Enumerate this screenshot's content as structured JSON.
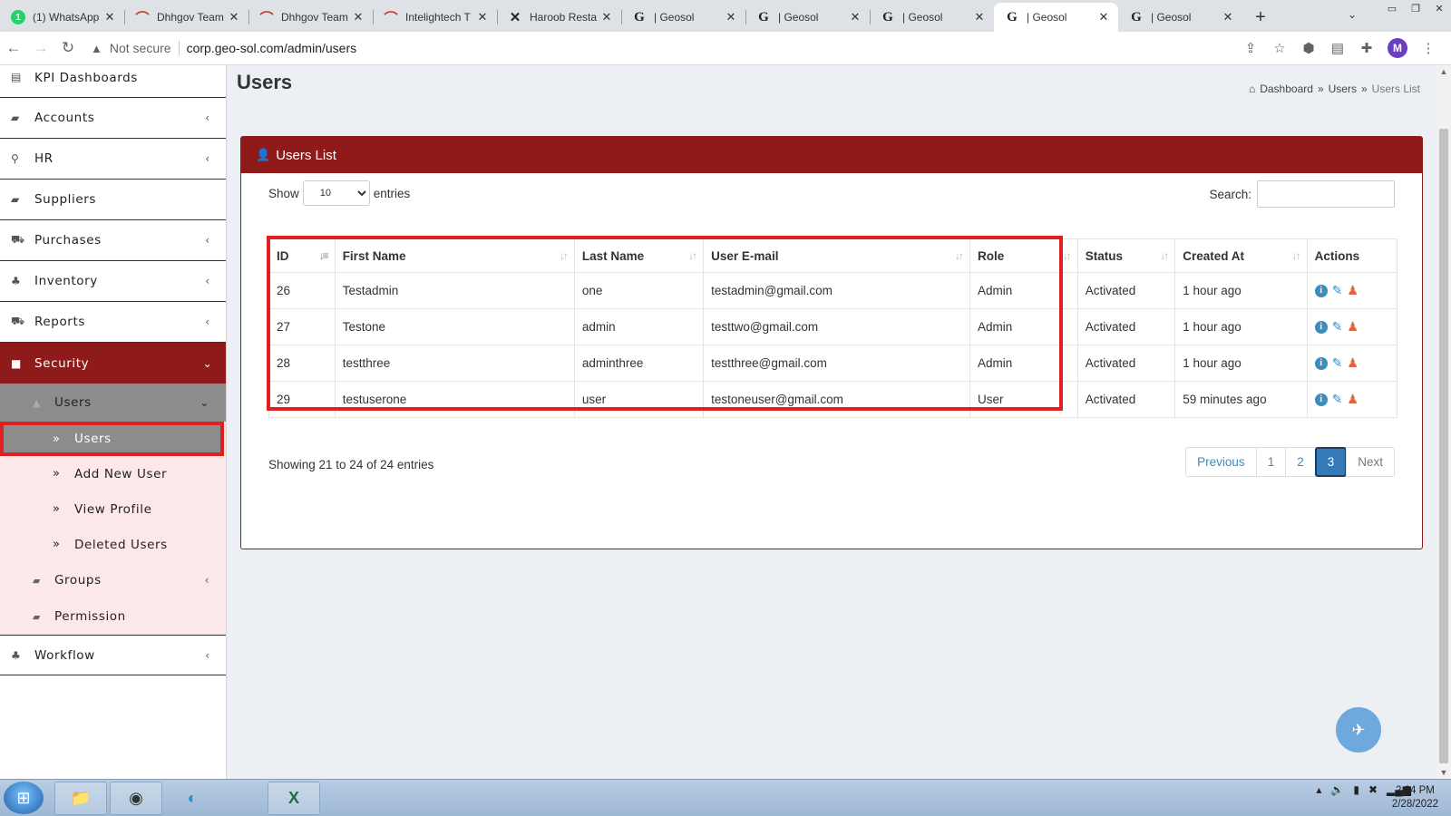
{
  "browser": {
    "tabs": [
      {
        "favicon": "whatsapp-icon",
        "glyph": "1",
        "title": "(1) WhatsApp"
      },
      {
        "favicon": "arc-icon",
        "glyph": "⌒",
        "title": "Dhhgov Team"
      },
      {
        "favicon": "arc-icon",
        "glyph": "⌒",
        "title": "Dhhgov Team"
      },
      {
        "favicon": "arc-icon",
        "glyph": "⌒",
        "title": "Intelightech T"
      },
      {
        "favicon": "x-icon",
        "glyph": "✕",
        "title": "Haroob Resta"
      },
      {
        "favicon": "g-icon",
        "glyph": "G",
        "title": "| Geosol"
      },
      {
        "favicon": "g-icon",
        "glyph": "G",
        "title": "| Geosol"
      },
      {
        "favicon": "g-icon",
        "glyph": "G",
        "title": "| Geosol"
      },
      {
        "favicon": "g-icon",
        "glyph": "G",
        "title": "| Geosol"
      },
      {
        "favicon": "g-icon",
        "glyph": "G",
        "title": "| Geosol"
      }
    ],
    "active_tab": 8,
    "security_label": "Not secure",
    "url": "corp.geo-sol.com/admin/users",
    "avatar_letter": "M"
  },
  "sidebar": {
    "items_top": [
      {
        "label": "KPI Dashboards",
        "icon": "dashboard-icon",
        "glyph": "▤",
        "chevron": false
      },
      {
        "label": "Accounts",
        "icon": "accounts-icon",
        "glyph": "▰",
        "chevron": true
      },
      {
        "label": "HR",
        "icon": "hr-icon",
        "glyph": "⚲",
        "chevron": true
      },
      {
        "label": "Suppliers",
        "icon": "truck-icon",
        "glyph": "▰",
        "chevron": false
      },
      {
        "label": "Purchases",
        "icon": "cart-icon",
        "glyph": "⛟",
        "chevron": true
      },
      {
        "label": "Inventory",
        "icon": "sitemap-icon",
        "glyph": "♣",
        "chevron": true
      },
      {
        "label": "Reports",
        "icon": "cart-icon",
        "glyph": "⛟",
        "chevron": true
      }
    ],
    "security": {
      "label": "Security",
      "glyph": "🔒"
    },
    "users_group": {
      "label": "Users"
    },
    "users_children": [
      {
        "label": "Users"
      },
      {
        "label": "Add New User"
      },
      {
        "label": "View Profile"
      },
      {
        "label": "Deleted Users"
      }
    ],
    "groups": {
      "label": "Groups"
    },
    "permission": {
      "label": "Permission"
    },
    "workflow": {
      "label": "Workflow"
    }
  },
  "page": {
    "title": "Users",
    "breadcrumb": [
      "Dashboard",
      "Users",
      "Users List"
    ],
    "box_title": "Users List"
  },
  "table": {
    "show_label": "Show",
    "entries_label": "entries",
    "page_size": "10",
    "search_label": "Search:",
    "search_value": "",
    "columns": [
      "ID",
      "First Name",
      "Last Name",
      "User E-mail",
      "Role",
      "Status",
      "Created At",
      "Actions"
    ],
    "rows": [
      {
        "id": "26",
        "first": "Testadmin",
        "last": "one",
        "email": "testadmin@gmail.com",
        "role": "Admin",
        "status": "Activated",
        "created": "1 hour ago"
      },
      {
        "id": "27",
        "first": "Testone",
        "last": "admin",
        "email": "testtwo@gmail.com",
        "role": "Admin",
        "status": "Activated",
        "created": "1 hour ago"
      },
      {
        "id": "28",
        "first": "testthree",
        "last": "adminthree",
        "email": "testthree@gmail.com",
        "role": "Admin",
        "status": "Activated",
        "created": "1 hour ago"
      },
      {
        "id": "29",
        "first": "testuserone",
        "last": "user",
        "email": "testoneuser@gmail.com",
        "role": "User",
        "status": "Activated",
        "created": "59 minutes ago"
      }
    ],
    "info": "Showing 21 to 24 of 24 entries",
    "pagination": {
      "previous": "Previous",
      "pages": [
        "1",
        "2",
        "3"
      ],
      "current": "3",
      "next": "Next"
    }
  },
  "taskbar": {
    "time": "2:24 PM",
    "date": "2/28/2022"
  },
  "colors": {
    "brand": "#8e1a1a",
    "highlight": "#e02020",
    "link": "#3c8dbc"
  }
}
